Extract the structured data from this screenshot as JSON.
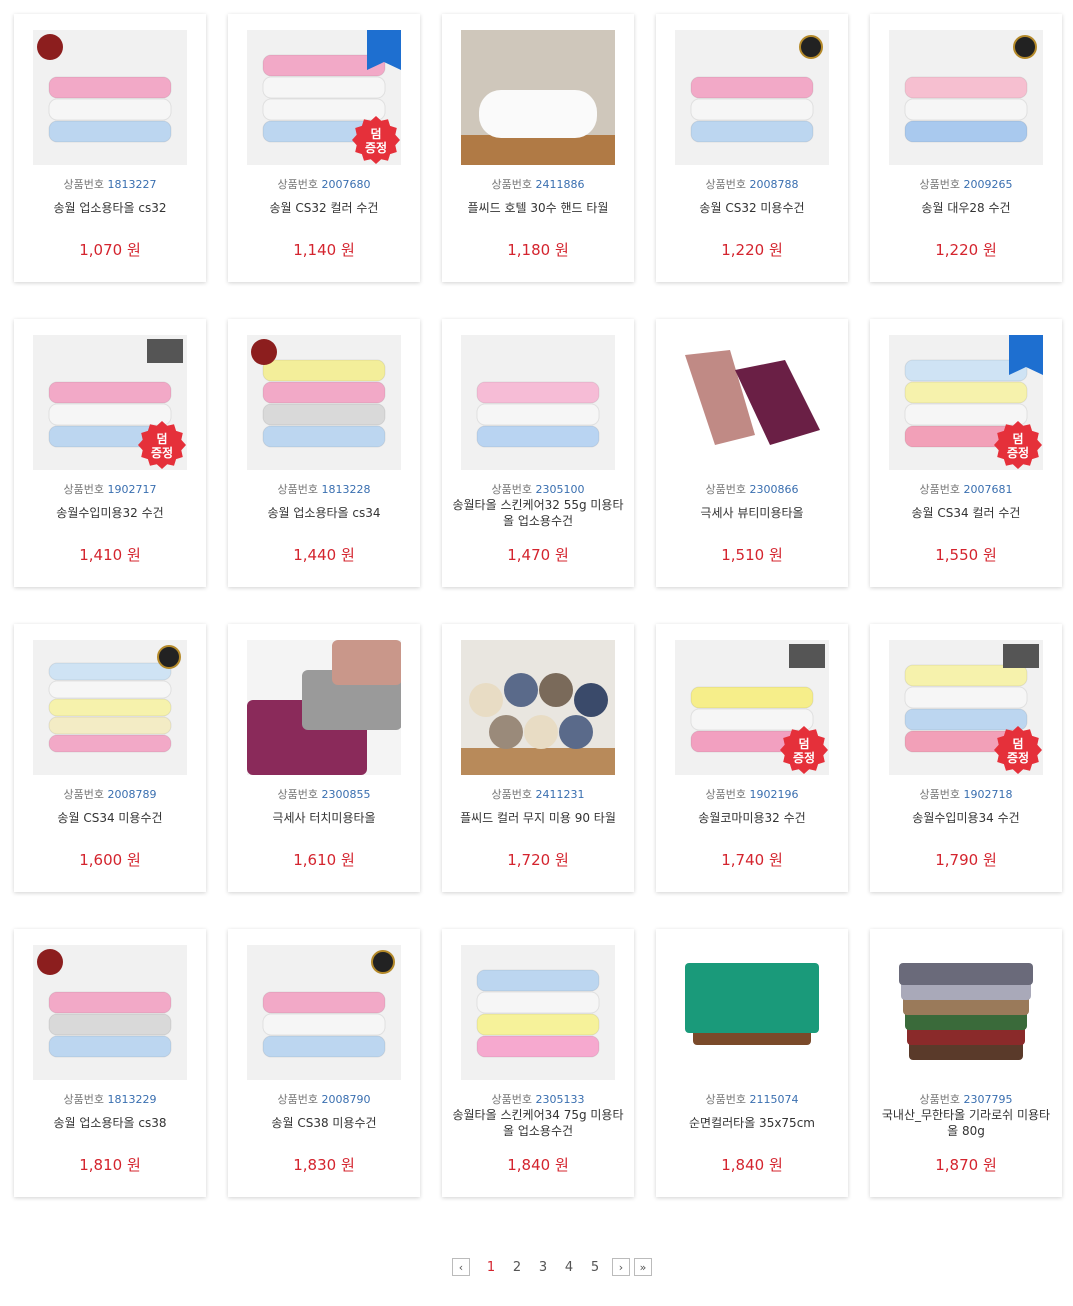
{
  "code_label": "상품번호",
  "currency": "원",
  "gift_badge_text": "덤\n증정",
  "products": [
    {
      "code": "1813227",
      "name": "송월 업소용타올 cs32",
      "price": "1,070",
      "colors": [
        "#f2a9c7",
        "#f6f6f6",
        "#bcd6f0"
      ],
      "badge": "red-seal",
      "gift": false
    },
    {
      "code": "2007680",
      "name": "송월 CS32 컬러 수건",
      "price": "1,140",
      "colors": [
        "#f2a9c7",
        "#f6f6f6",
        "#f6f6f6",
        "#bcd6f0"
      ],
      "badge": "blue-ribbon",
      "gift": true
    },
    {
      "code": "2411886",
      "name": "플씨드 호텔 30수 핸드 타월",
      "price": "1,180",
      "colors": [
        "#fafafa"
      ],
      "badge": "plcebe",
      "gift": false,
      "photo": "rolled-white"
    },
    {
      "code": "2008788",
      "name": "송월 CS32 미용수건",
      "price": "1,220",
      "colors": [
        "#f2a9c7",
        "#f6f6f6",
        "#bcd6f0"
      ],
      "badge": "round-seal",
      "gift": false
    },
    {
      "code": "2009265",
      "name": "송월 대우28 수건",
      "price": "1,220",
      "colors": [
        "#f6bfd0",
        "#f6f6f6",
        "#a9c9ee"
      ],
      "badge": "round-seal",
      "gift": false
    },
    {
      "code": "1902717",
      "name": "송월수입미용32 수건",
      "price": "1,410",
      "colors": [
        "#f2a9c7",
        "#f6f6f6",
        "#bcd6f0"
      ],
      "badge": "dark-logo",
      "gift": true
    },
    {
      "code": "1813228",
      "name": "송월 업소용타올 cs34",
      "price": "1,440",
      "colors": [
        "#f3ee9a",
        "#f2a9c7",
        "#d9d9d9",
        "#bcd6f0"
      ],
      "badge": "red-seal",
      "gift": false
    },
    {
      "code": "2305100",
      "name": "송월타올 스킨케어32 55g 미용타올 업소용수건",
      "price": "1,470",
      "colors": [
        "#f6bcd6",
        "#f6f6f6",
        "#b9d4f2"
      ],
      "badge": "none",
      "gift": false
    },
    {
      "code": "2300866",
      "name": "극세사 뷰티미용타올",
      "price": "1,510",
      "colors": [
        "#c08a85",
        "#6a1f45"
      ],
      "badge": "none",
      "gift": false,
      "photo": "mats"
    },
    {
      "code": "2007681",
      "name": "송월 CS34 컬러 수건",
      "price": "1,550",
      "colors": [
        "#cfe3f4",
        "#f6f2ac",
        "#f6f6f6",
        "#f2a0b8"
      ],
      "badge": "blue-ribbon",
      "gift": true
    },
    {
      "code": "2008789",
      "name": "송월 CS34 미용수건",
      "price": "1,600",
      "colors": [
        "#cfe3f4",
        "#f6f6f6",
        "#f6f2ac",
        "#f3ecc5",
        "#f2a9c7"
      ],
      "badge": "round-seal",
      "gift": false
    },
    {
      "code": "2300855",
      "name": "극세사 터치미용타올",
      "price": "1,610",
      "colors": [
        "#8a2a5a",
        "#9a9a9a",
        "#c9978a"
      ],
      "badge": "none",
      "gift": false,
      "photo": "folded-dark"
    },
    {
      "code": "2411231",
      "name": "플씨드 컬러 무지 미용 90 타월",
      "price": "1,720",
      "colors": [
        "#e8dcc4",
        "#5a6a8a",
        "#7a6a5a",
        "#3a4a6a",
        "#9a8a7a"
      ],
      "badge": "plcebe",
      "gift": false,
      "photo": "rolls"
    },
    {
      "code": "1902196",
      "name": "송월코마미용32 수건",
      "price": "1,740",
      "colors": [
        "#f6ee8a",
        "#f6f6f6",
        "#f2a0c0"
      ],
      "badge": "dark-logo",
      "gift": true
    },
    {
      "code": "1902718",
      "name": "송월수입미용34 수건",
      "price": "1,790",
      "colors": [
        "#f6f2ac",
        "#f6f6f6",
        "#bcd6f0",
        "#f2a0b8"
      ],
      "badge": "dark-logo",
      "gift": true
    },
    {
      "code": "1813229",
      "name": "송월 업소용타올 cs38",
      "price": "1,810",
      "colors": [
        "#f2a9c7",
        "#d9d9d9",
        "#bcd6f0"
      ],
      "badge": "red-seal",
      "gift": false
    },
    {
      "code": "2008790",
      "name": "송월 CS38 미용수건",
      "price": "1,830",
      "colors": [
        "#f2a9c7",
        "#f6f6f6",
        "#bcd6f0"
      ],
      "badge": "round-seal",
      "gift": false
    },
    {
      "code": "2305133",
      "name": "송월타올 스킨케어34 75g 미용타올 업소용수건",
      "price": "1,840",
      "colors": [
        "#bcd6f0",
        "#f6f6f6",
        "#f6f29a",
        "#f6a9cf"
      ],
      "badge": "none",
      "gift": false
    },
    {
      "code": "2115074",
      "name": "순면컬러타올 35x75cm",
      "price": "1,840",
      "colors": [
        "#1a9a7a",
        "#d42a2a",
        "#f6f6f6",
        "#e86a2a",
        "#7a4a2a"
      ],
      "badge": "none",
      "gift": false,
      "photo": "green-stack"
    },
    {
      "code": "2307795",
      "name": "국내산_무한타올 기라로쉬 미용타올 80g",
      "price": "1,870",
      "colors": [
        "#6a6a7a",
        "#a9a9b9",
        "#9a7a5a",
        "#3a6a3a",
        "#8a2a2a",
        "#5a3a2a"
      ],
      "badge": "none",
      "gift": false,
      "photo": "multi-stack"
    }
  ],
  "pagination": {
    "prev": "‹",
    "pages": [
      "1",
      "2",
      "3",
      "4",
      "5"
    ],
    "active": "1",
    "next": "›",
    "last": "»"
  },
  "colors": {
    "price": "#d4242e",
    "code_number": "#3a6fb0",
    "gift_badge": "#e5303a"
  }
}
